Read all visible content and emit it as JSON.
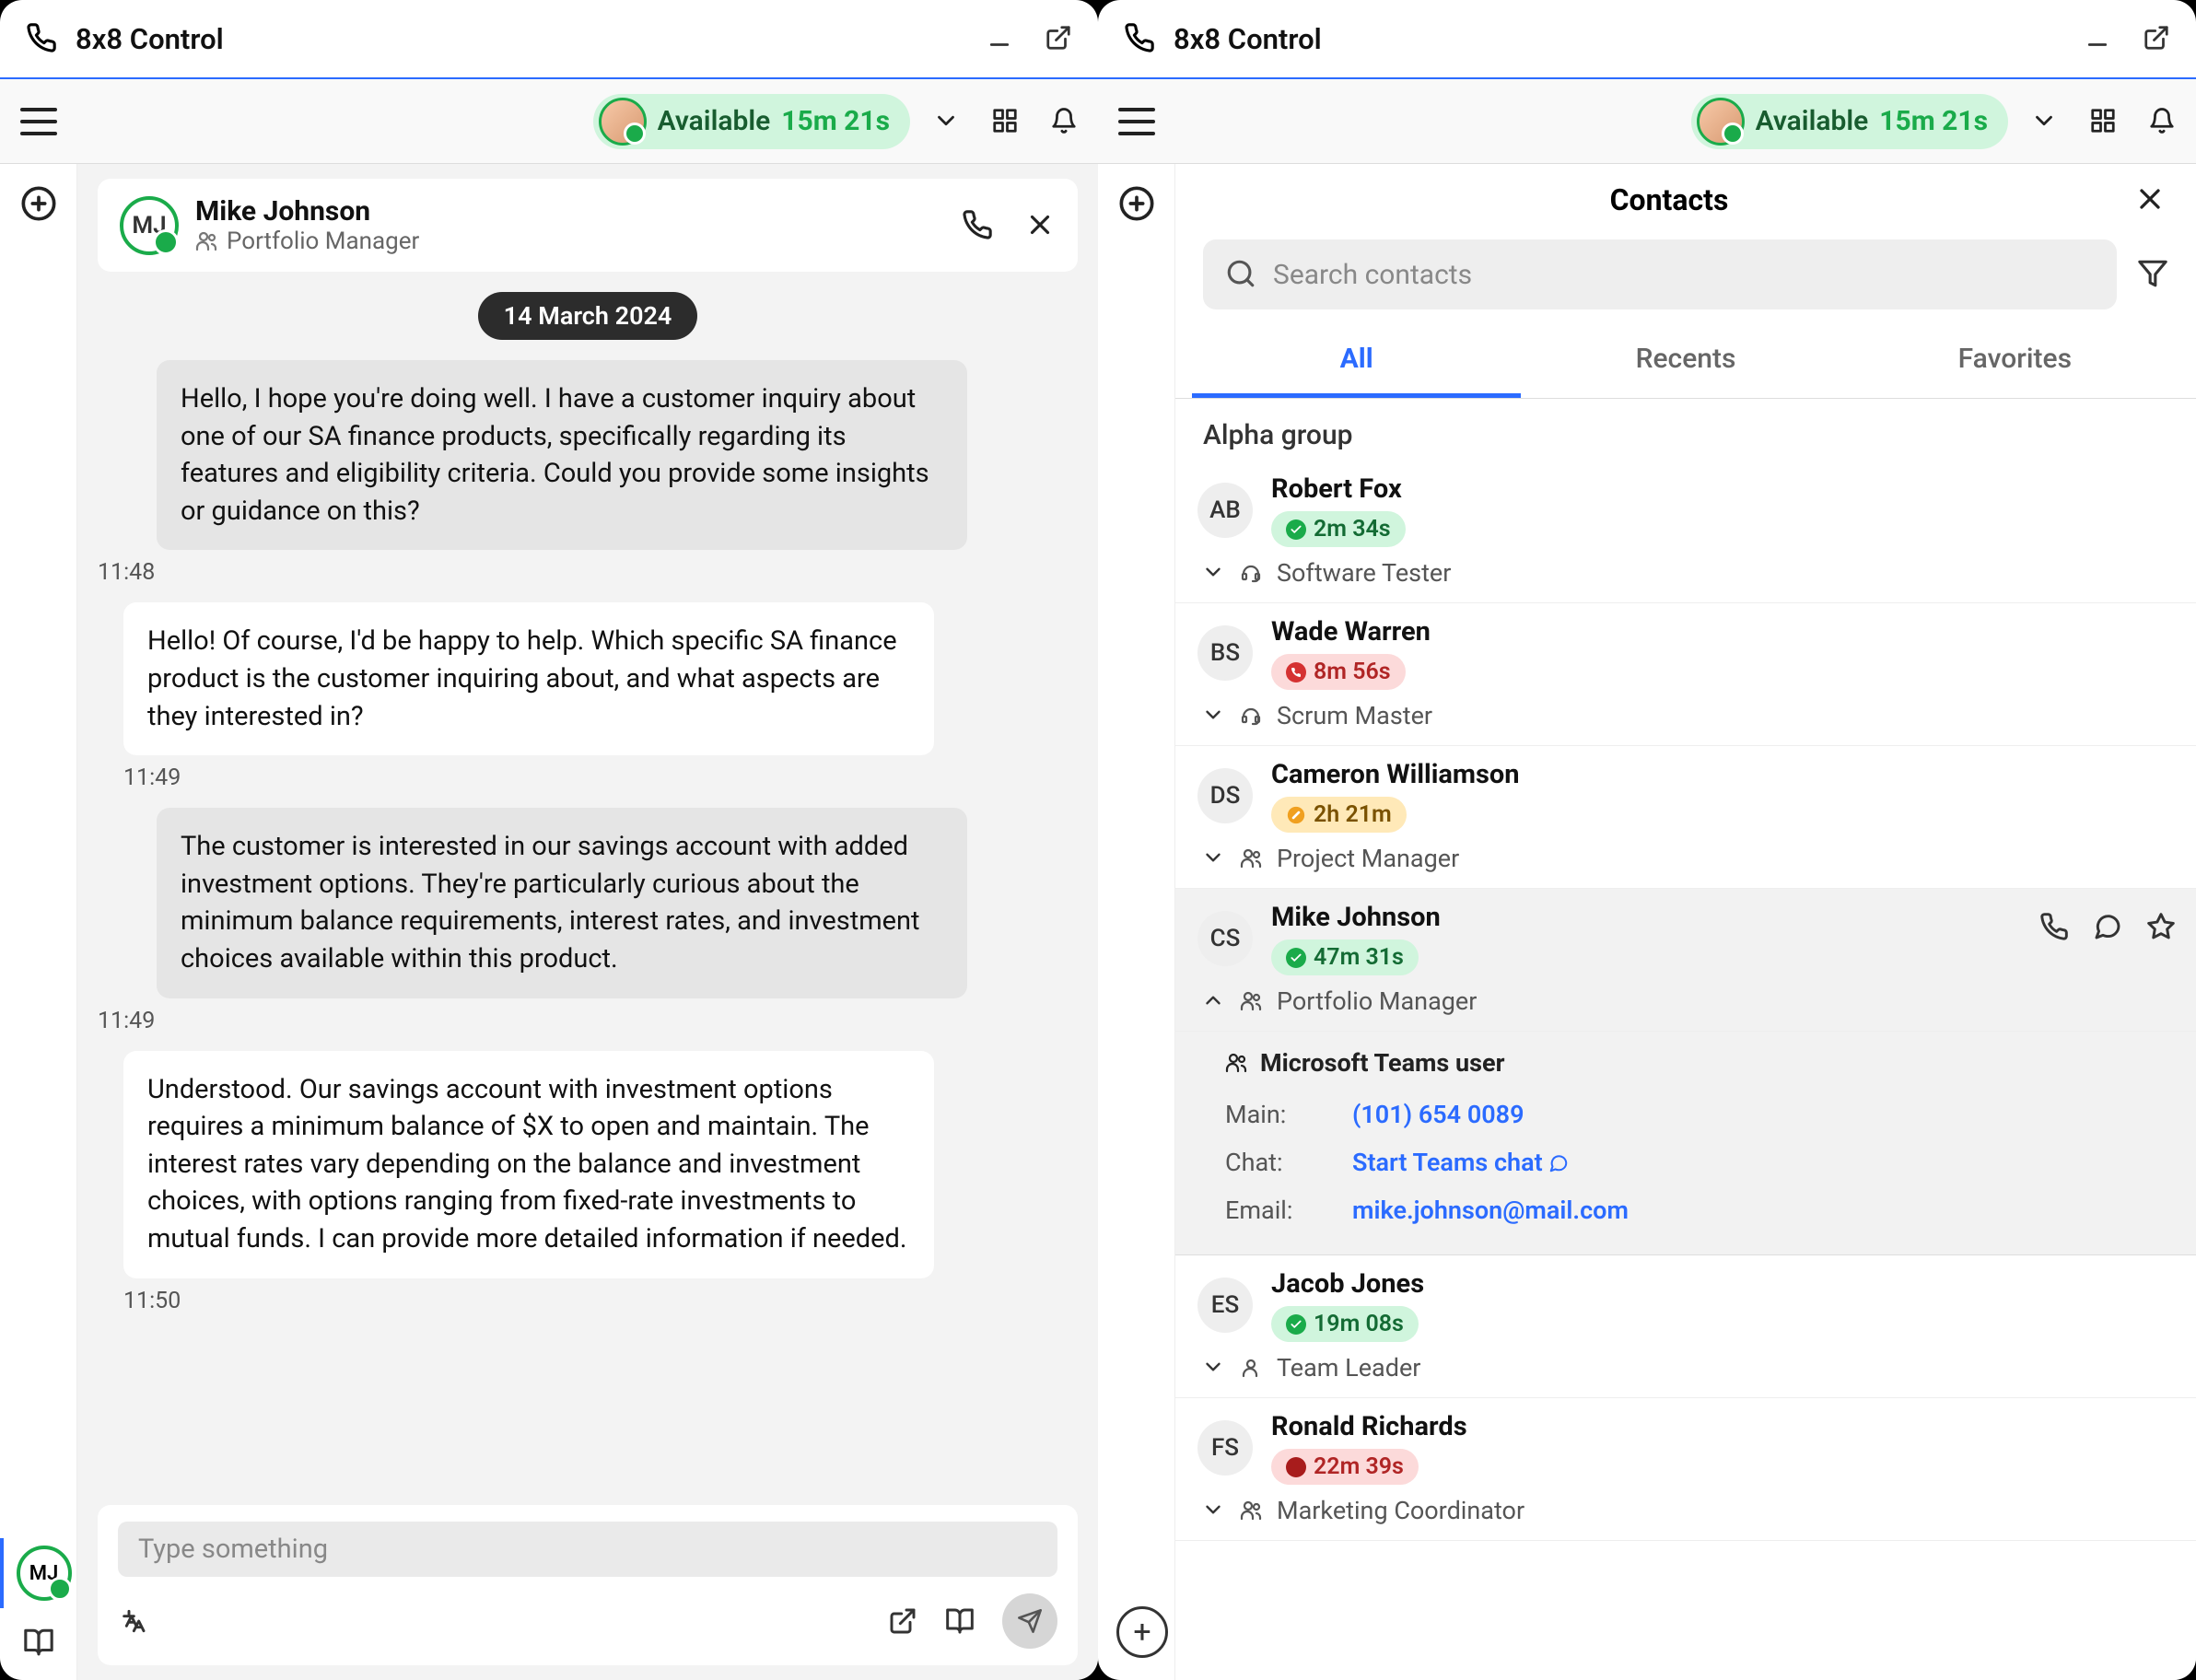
{
  "app_title": "8x8 Control",
  "status": {
    "text": "Available",
    "time": "15m 21s"
  },
  "chat": {
    "header": {
      "initials": "MJ",
      "name": "Mike Johnson",
      "role": "Portfolio Manager"
    },
    "date": "14 March 2024",
    "messages": [
      {
        "dir": "in",
        "text": "Hello, I hope you're doing well. I have a customer inquiry about one of our SA finance products, specifically regarding its features and eligibility criteria. Could you provide some insights or guidance on this?",
        "time": "11:48"
      },
      {
        "dir": "out",
        "text": "Hello! Of course, I'd be happy to help. Which specific SA finance product is the customer inquiring about, and what aspects are they interested in?",
        "time": "11:49"
      },
      {
        "dir": "in",
        "text": "The customer is interested in our savings account with added investment options. They're particularly curious about the minimum balance requirements, interest rates, and investment choices available within this product.",
        "time": "11:49"
      },
      {
        "dir": "out",
        "text": "Understood. Our savings account with investment options requires a minimum balance of $X to open and maintain. The interest rates vary depending on the balance and investment choices, with options ranging from fixed-rate investments to mutual funds. I can provide more detailed information if needed.",
        "time": "11:50"
      }
    ],
    "composer_placeholder": "Type something"
  },
  "contacts": {
    "title": "Contacts",
    "search_placeholder": "Search contacts",
    "tabs": {
      "all": "All",
      "recents": "Recents",
      "favorites": "Favorites"
    },
    "group_header": "Alpha group",
    "list": [
      {
        "initials": "AB",
        "name": "Robert Fox",
        "badge_class": "green",
        "badge_dot": "green",
        "time": "2m 34s",
        "role": "Software Tester",
        "teams_icon": false,
        "headset": true,
        "expanded": false
      },
      {
        "initials": "BS",
        "name": "Wade Warren",
        "badge_class": "red",
        "badge_dot": "red",
        "time": "8m 56s",
        "role": "Scrum Master",
        "teams_icon": false,
        "headset": true,
        "expanded": false
      },
      {
        "initials": "DS",
        "name": "Cameron Williamson",
        "badge_class": "amber",
        "badge_dot": "amber",
        "time": "2h 21m",
        "role": "Project Manager",
        "teams_icon": true,
        "headset": false,
        "expanded": false
      },
      {
        "initials": "CS",
        "name": "Mike Johnson",
        "badge_class": "green",
        "badge_dot": "green",
        "time": "47m 31s",
        "role": "Portfolio Manager",
        "teams_icon": true,
        "headset": false,
        "expanded": true,
        "details": {
          "header": "Microsoft Teams user",
          "main_label": "Main:",
          "main_value": "(101) 654 0089",
          "chat_label": "Chat:",
          "chat_value": "Start Teams chat",
          "email_label": "Email:",
          "email_value": "mike.johnson@mail.com"
        }
      },
      {
        "initials": "ES",
        "name": "Jacob Jones",
        "badge_class": "green",
        "badge_dot": "green",
        "time": "19m 08s",
        "role": "Team Leader",
        "teams_icon": false,
        "headset": false,
        "person": true,
        "expanded": false
      },
      {
        "initials": "FS",
        "name": "Ronald Richards",
        "badge_class": "red",
        "badge_dot": "darkred",
        "time": "22m 39s",
        "role": "Marketing Coordinator",
        "teams_icon": true,
        "headset": false,
        "expanded": false
      }
    ]
  }
}
